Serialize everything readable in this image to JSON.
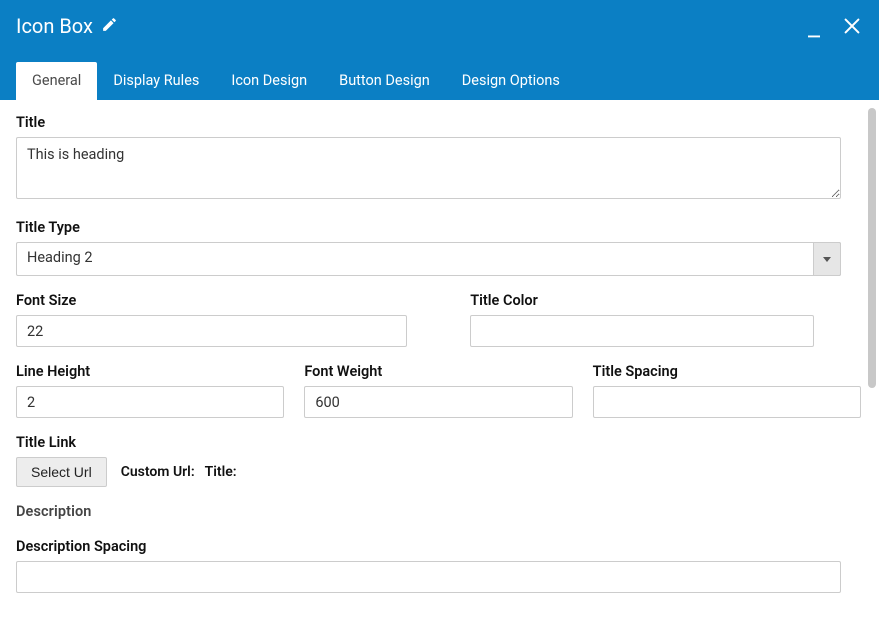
{
  "header": {
    "title": "Icon Box",
    "icons": {
      "edit": "pencil-icon",
      "minimize": "minimize-icon",
      "close": "close-icon"
    }
  },
  "tabs": [
    {
      "label": "General",
      "active": true
    },
    {
      "label": "Display Rules",
      "active": false
    },
    {
      "label": "Icon Design",
      "active": false
    },
    {
      "label": "Button Design",
      "active": false
    },
    {
      "label": "Design Options",
      "active": false
    }
  ],
  "fields": {
    "title": {
      "label": "Title",
      "value": "This is heading"
    },
    "titleType": {
      "label": "Title Type",
      "value": "Heading 2"
    },
    "fontSize": {
      "label": "Font Size",
      "value": "22"
    },
    "titleColor": {
      "label": "Title Color",
      "value": ""
    },
    "lineHeight": {
      "label": "Line Height",
      "value": "2"
    },
    "fontWeight": {
      "label": "Font Weight",
      "value": "600"
    },
    "titleSpacing": {
      "label": "Title Spacing",
      "value": ""
    },
    "titleLink": {
      "label": "Title Link",
      "button": "Select Url",
      "customUrlLabel": "Custom Url:",
      "titleLabel": "Title:"
    },
    "description": {
      "label": "Description"
    },
    "descriptionSpacing": {
      "label": "Description Spacing",
      "value": ""
    }
  }
}
